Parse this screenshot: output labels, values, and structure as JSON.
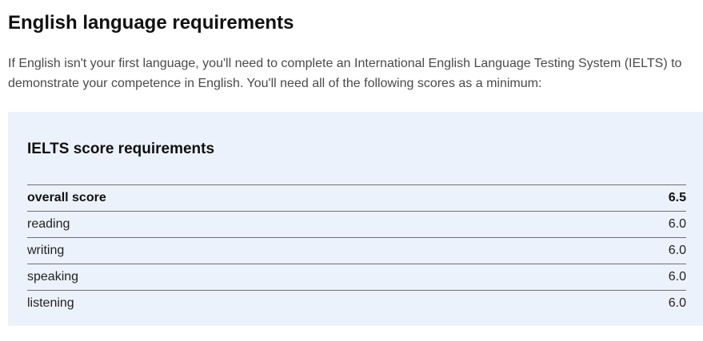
{
  "heading": "English language requirements",
  "intro": "If English isn't your first language, you'll need to complete an International English Language Testing System (IELTS) to demonstrate your competence in English. You'll need all of the following scores as a minimum:",
  "ielts": {
    "title": "IELTS score requirements",
    "rows": [
      {
        "label": "overall score",
        "score": "6.5"
      },
      {
        "label": "reading",
        "score": "6.0"
      },
      {
        "label": "writing",
        "score": "6.0"
      },
      {
        "label": "speaking",
        "score": "6.0"
      },
      {
        "label": "listening",
        "score": "6.0"
      }
    ]
  }
}
